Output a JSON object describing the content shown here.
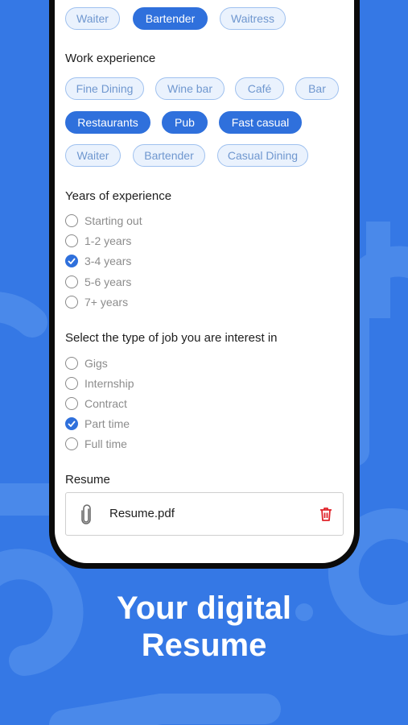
{
  "roles": {
    "chips": [
      {
        "label": "Waiter",
        "selected": false
      },
      {
        "label": "Bartender",
        "selected": true
      },
      {
        "label": "Waitress",
        "selected": false
      }
    ]
  },
  "work_experience": {
    "title": "Work experience",
    "row1": [
      {
        "label": "Fine Dining",
        "selected": false
      },
      {
        "label": "Wine bar",
        "selected": false
      },
      {
        "label": "Café",
        "selected": false
      },
      {
        "label": "Bar",
        "selected": false
      }
    ],
    "row2": [
      {
        "label": "Restaurants",
        "selected": true
      },
      {
        "label": "Pub",
        "selected": true
      },
      {
        "label": "Fast casual",
        "selected": true
      }
    ],
    "row3": [
      {
        "label": "Waiter",
        "selected": false
      },
      {
        "label": "Bartender",
        "selected": false
      },
      {
        "label": "Casual Dining",
        "selected": false
      }
    ]
  },
  "years": {
    "title": "Years of experience",
    "options": [
      {
        "label": "Starting out",
        "checked": false
      },
      {
        "label": "1-2 years",
        "checked": false
      },
      {
        "label": "3-4 years",
        "checked": true
      },
      {
        "label": "5-6 years",
        "checked": false
      },
      {
        "label": "7+ years",
        "checked": false
      }
    ]
  },
  "job_type": {
    "title": "Select the type of job you are interest in",
    "options": [
      {
        "label": "Gigs",
        "checked": false
      },
      {
        "label": "Internship",
        "checked": false
      },
      {
        "label": "Contract",
        "checked": false
      },
      {
        "label": "Part time",
        "checked": true
      },
      {
        "label": "Full time",
        "checked": false
      }
    ]
  },
  "resume": {
    "title": "Resume",
    "file_name": "Resume.pdf",
    "attach_icon": "paperclip-icon",
    "delete_icon": "trash-icon"
  },
  "headline": {
    "line1": "Your digital",
    "line2": "Resume"
  },
  "colors": {
    "background": "#3578e5",
    "accent": "#2f70dc",
    "delete": "#e0242b"
  }
}
